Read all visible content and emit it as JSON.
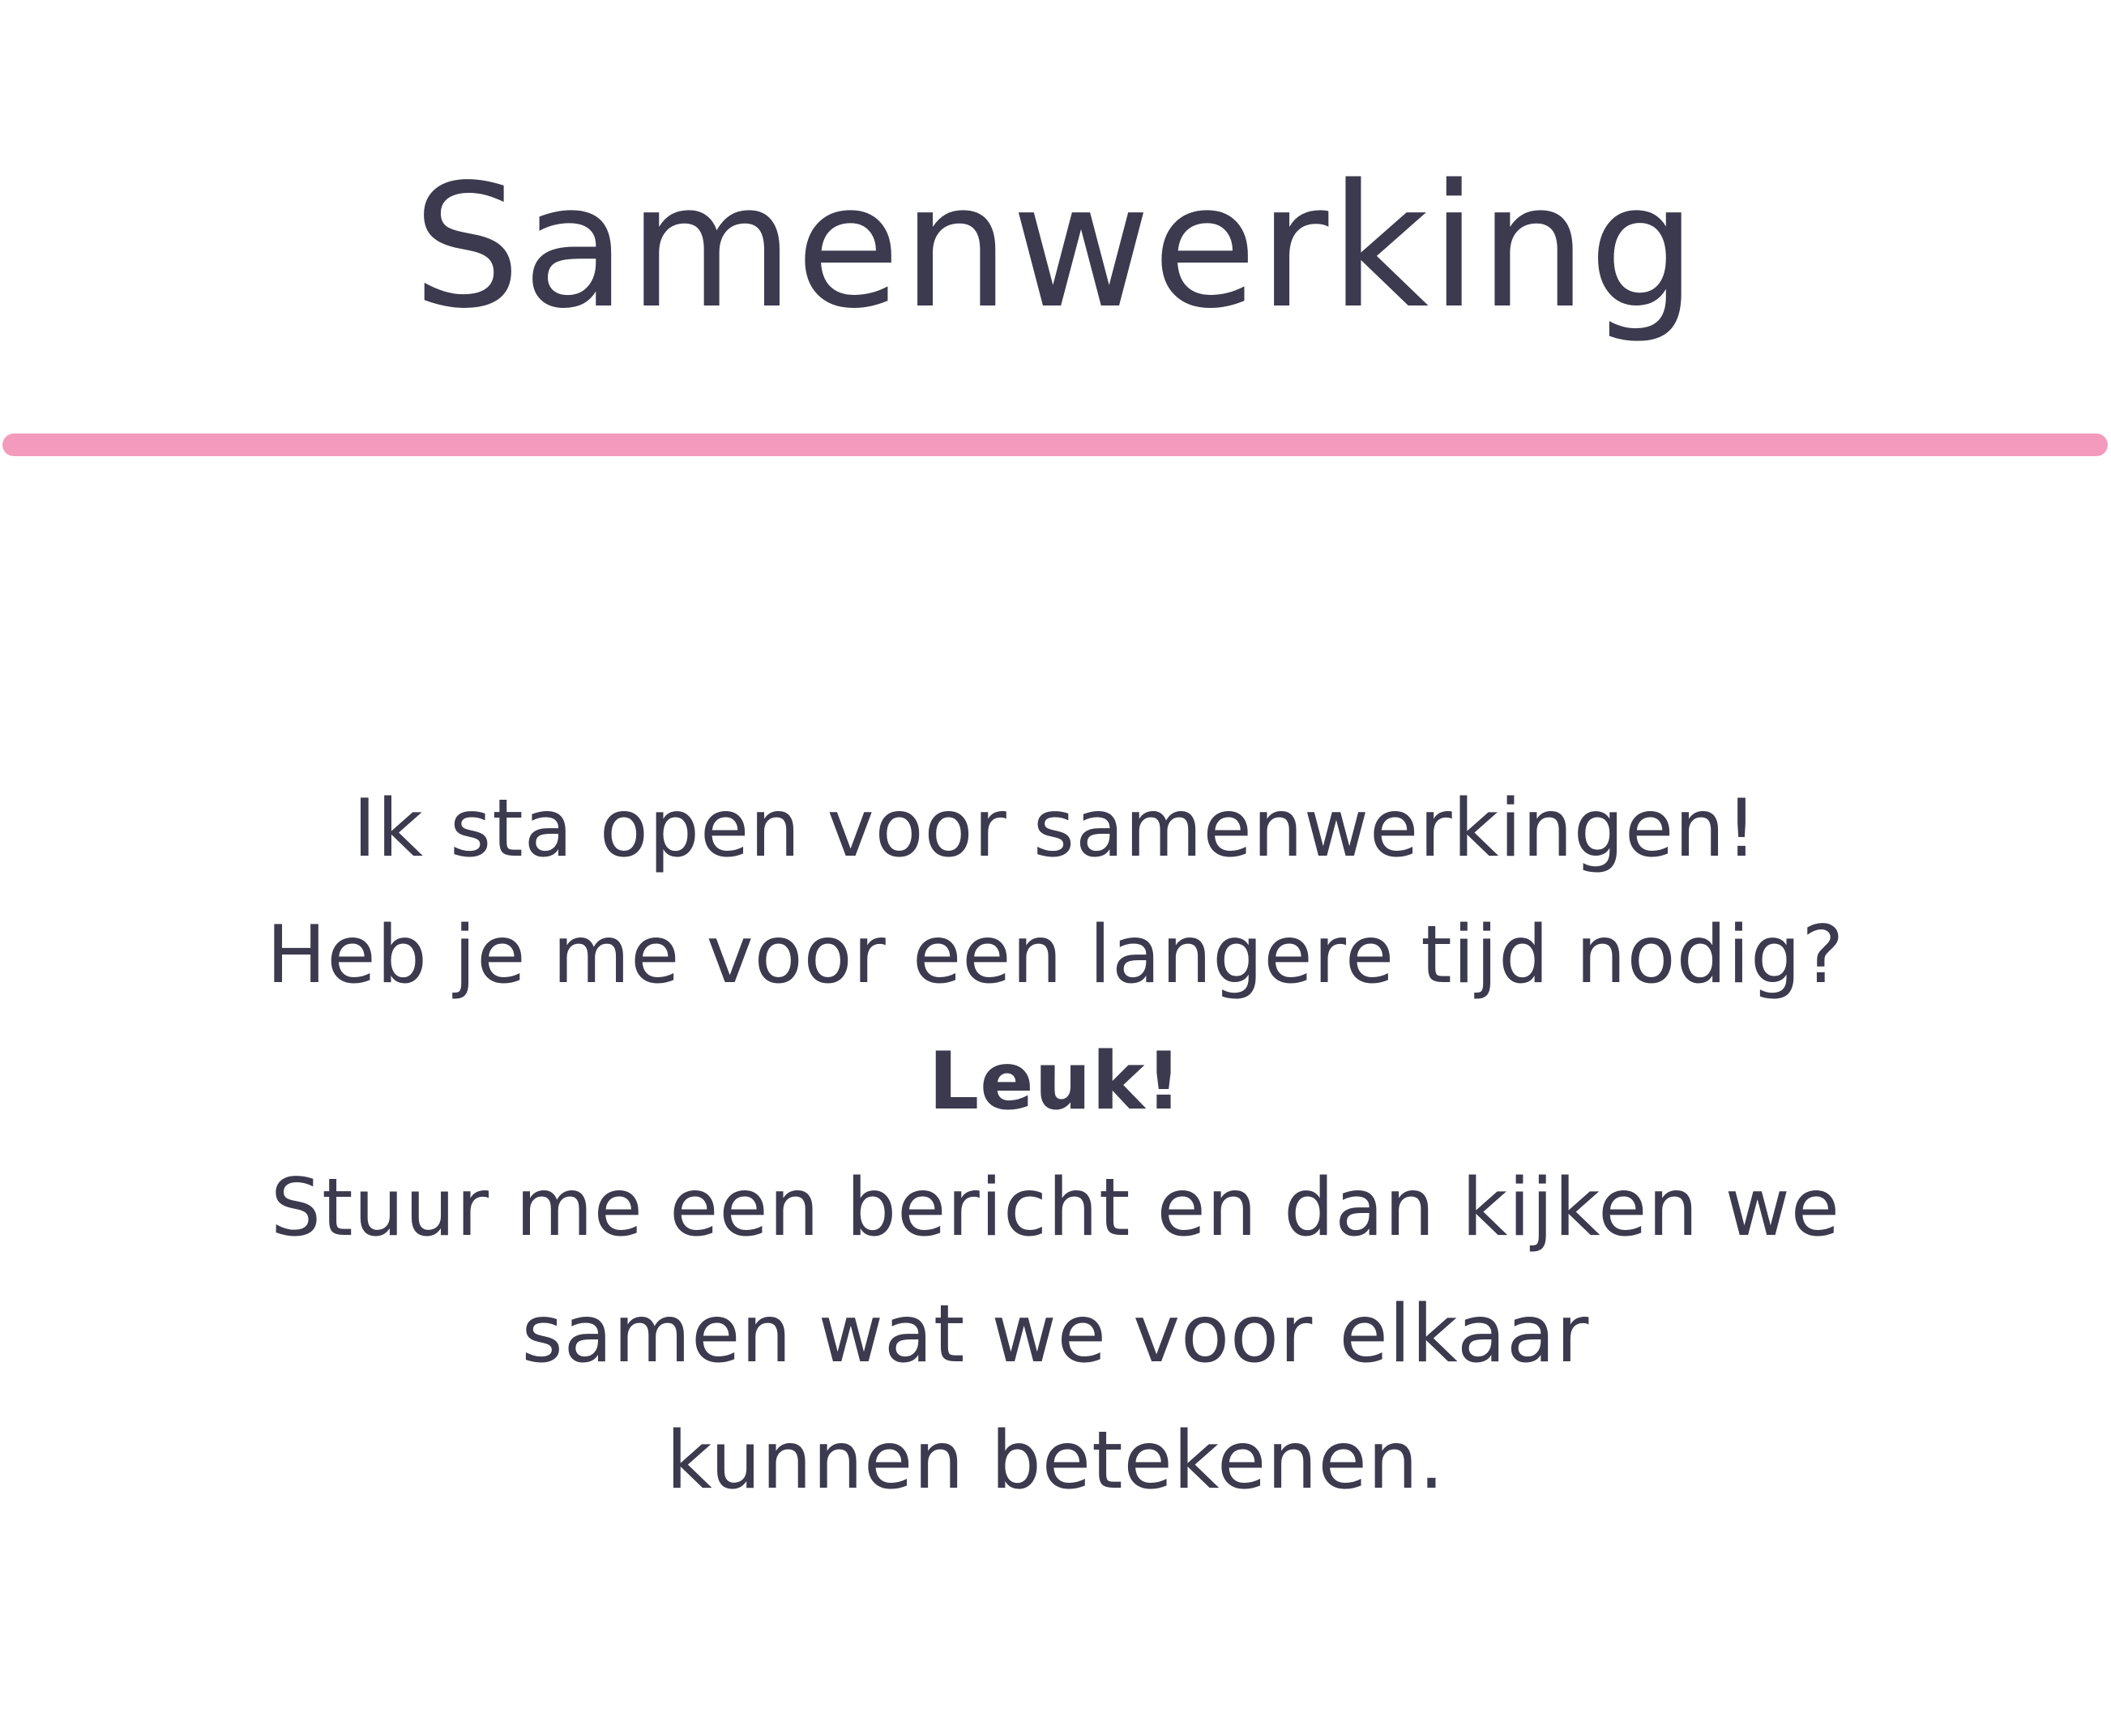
{
  "title": "Samenwerking",
  "accent_color": "#f49bbd",
  "text_color": "#3b3a4e",
  "lines": [
    "Ik sta open voor samenwerkingen!",
    "Heb je me voor een langere tijd nodig?",
    "Leuk!",
    "Stuur me een bericht en dan kijken we",
    "samen wat we voor elkaar",
    "kunnen betekenen."
  ]
}
